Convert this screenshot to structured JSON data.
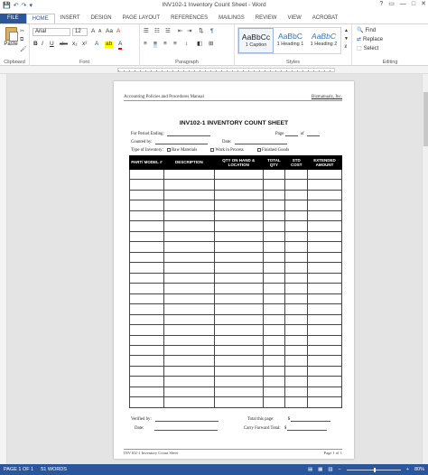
{
  "window": {
    "title": "INV102-1 Inventory Count Sheet - Word",
    "controls": [
      "?",
      "▭",
      "—",
      "□",
      "✕"
    ]
  },
  "qat": {
    "save": "💾",
    "undo": "↶",
    "redo": "↷",
    "more": "▾"
  },
  "tabs": [
    "FILE",
    "HOME",
    "INSERT",
    "DESIGN",
    "PAGE LAYOUT",
    "REFERENCES",
    "MAILINGS",
    "REVIEW",
    "VIEW",
    "ACROBAT"
  ],
  "ribbon": {
    "clipboard": {
      "label": "Clipboard",
      "paste": "Paste"
    },
    "font": {
      "label": "Font",
      "name": "Arial",
      "size": "12",
      "bold": "B",
      "italic": "I",
      "underline": "U",
      "strike": "abc",
      "sub": "x₂",
      "sup": "x²",
      "grow": "A",
      "shrink": "A",
      "case": "Aa",
      "clear": "A",
      "highlight": "ab",
      "color": "A"
    },
    "paragraph": {
      "label": "Paragraph"
    },
    "styles": {
      "label": "Styles",
      "items": [
        {
          "sample": "AaBbCc",
          "name": "1 Caption"
        },
        {
          "sample": "AaBbC",
          "name": "1 Heading 1"
        },
        {
          "sample": "AaBbC",
          "name": "1 Heading 2"
        }
      ]
    },
    "editing": {
      "label": "Editing",
      "find": "Find",
      "replace": "Replace",
      "select": "Select"
    }
  },
  "page": {
    "header_left": "Accounting Policies and Procedures Manual",
    "header_right": "Bizmanualz, Inc.",
    "title": "INV102-1 INVENTORY COUNT SHEET",
    "period_ending": "For Period Ending:",
    "page_label": "Page",
    "of_label": "of",
    "counted_by": "Counted by:",
    "date": "Date:",
    "type_label": "Type of Inventory:",
    "types": [
      "Raw Materials",
      "Work in Process",
      "Finished Goods"
    ],
    "columns": [
      "PART/ MODEL #",
      "DESCRIPTION",
      "QTY ON HAND & LOCATION",
      "TOTAL QTY",
      "STD COST",
      "EXTENDED AMOUNT"
    ],
    "verified_by": "Verified by:",
    "total_page": "Total this page:",
    "carry_forward": "Carry Forward Total:",
    "dollar": "$",
    "footer_left": "INV102-1 Inventory Count Sheet",
    "footer_right": "Page 1 of 1"
  },
  "status": {
    "page": "PAGE 1 OF 1",
    "words": "51 WORDS",
    "zoom": "80%",
    "zoom_level": 0.5
  }
}
